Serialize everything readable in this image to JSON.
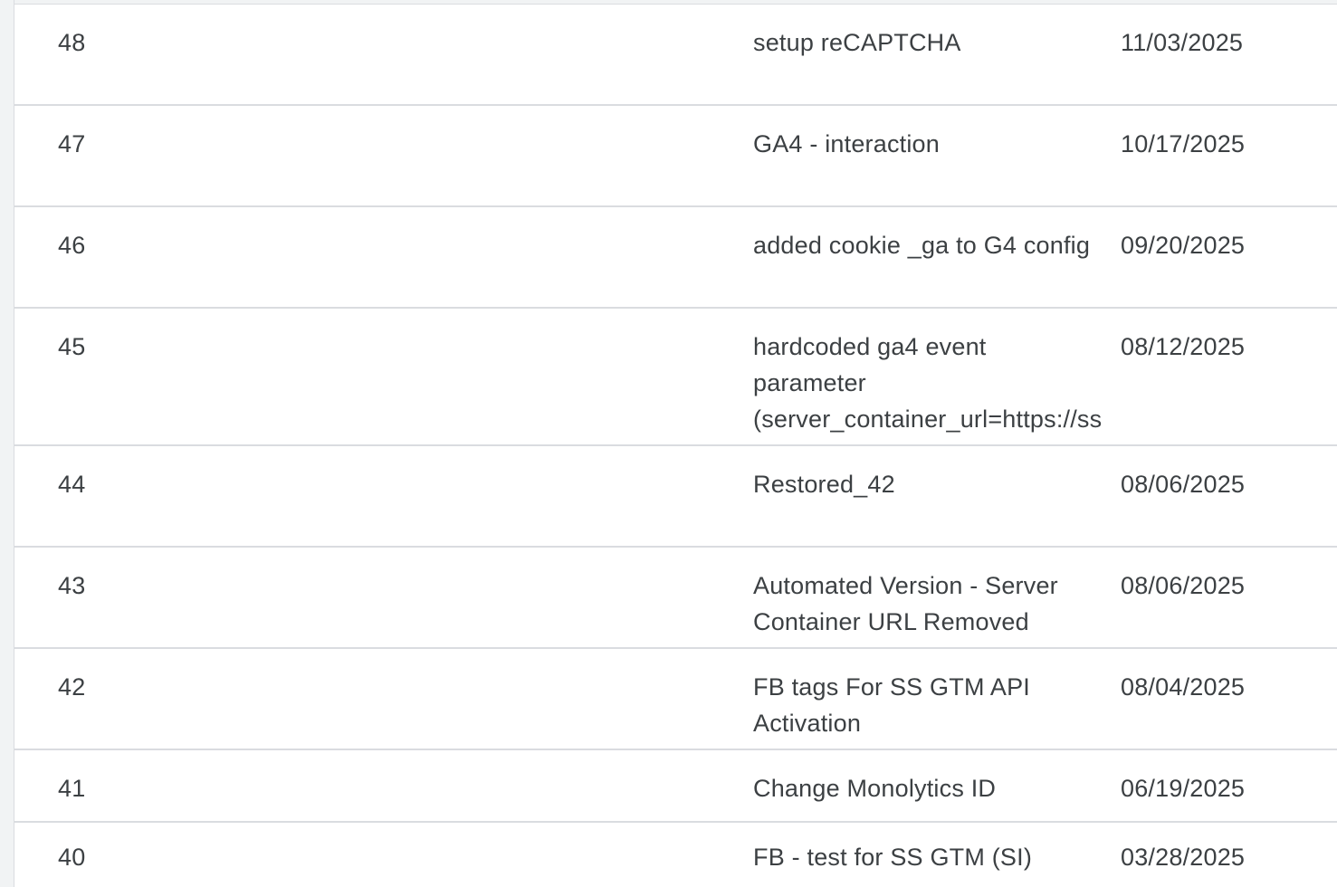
{
  "versions": [
    {
      "number": "48",
      "name_lines": [
        "setup reCAPTCHA"
      ],
      "date": "11/03/2025"
    },
    {
      "number": "47",
      "name_lines": [
        "GA4 - interaction"
      ],
      "date": "10/17/2025"
    },
    {
      "number": "46",
      "name_lines": [
        "added cookie _ga to G4 config"
      ],
      "date": "09/20/2025"
    },
    {
      "number": "45",
      "name_lines": [
        "hardcoded ga4 event",
        "parameter",
        "(server_container_url=https://ss"
      ],
      "date": "08/12/2025"
    },
    {
      "number": "44",
      "name_lines": [
        "Restored_42"
      ],
      "date": "08/06/2025"
    },
    {
      "number": "43",
      "name_lines": [
        "Automated Version - Server",
        "Container URL Removed"
      ],
      "date": "08/06/2025"
    },
    {
      "number": "42",
      "name_lines": [
        "FB tags For SS GTM API",
        "Activation"
      ],
      "date": "08/04/2025"
    },
    {
      "number": "41",
      "name_lines": [
        "Change Monolytics ID"
      ],
      "date": "06/19/2025"
    },
    {
      "number": "40",
      "name_lines": [
        "FB - test for SS GTM (SI)"
      ],
      "date": "03/28/2025"
    }
  ]
}
